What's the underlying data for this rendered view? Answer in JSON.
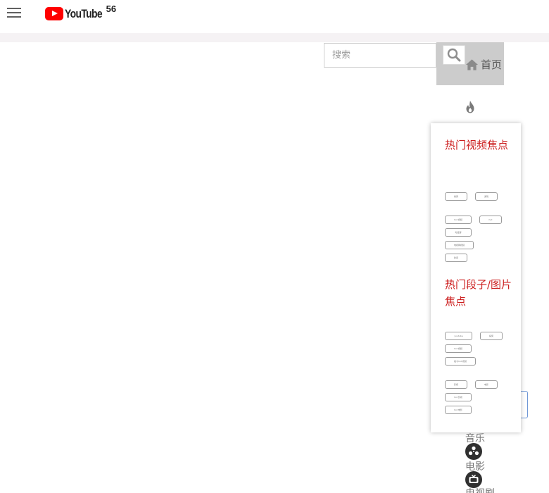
{
  "header": {
    "logo_text": "YouTube",
    "logo_sup": "56"
  },
  "search": {
    "placeholder": "搜索"
  },
  "nav": {
    "home_label": "首页",
    "music_label": "音乐",
    "movies_label": "电影",
    "tv_label": "电视剧"
  },
  "dropdown": {
    "section1_title": "热门视频焦点",
    "section2_title": "热门段子/图片焦点",
    "section1_chips": [
      "搞笑",
      "游戏",
      "hot 视频",
      "hot",
      "动漫游",
      "电视网视频",
      "新闻"
    ],
    "section2_chips": [
      "youtube",
      "搞笑",
      "hot 视频",
      "段子hot 视频",
      "影视",
      "电影",
      "hot 影视",
      "hot 电影"
    ]
  },
  "colors": {
    "accent_red": "#cc1e1e",
    "logo_red": "#ff0000",
    "nav_active_bg": "#cccccc"
  },
  "icons": [
    "menu-icon",
    "search-icon",
    "home-icon",
    "fire-icon",
    "film-reel-icon",
    "tv-icon"
  ]
}
